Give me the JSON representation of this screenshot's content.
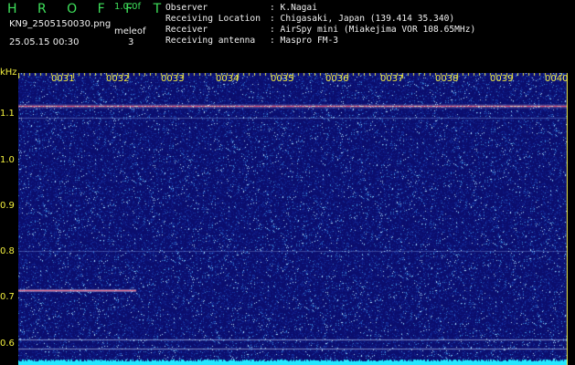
{
  "header": {
    "brand": "H R O F F T",
    "version": "1.0.0f",
    "filename": "KN9_2505150030.png",
    "meleof": "meleof",
    "datetime": "25.05.15 00:30",
    "value": "3",
    "observer_label": "Observer",
    "observer_value": ": K.Nagai",
    "location_label": "Receiving Location",
    "location_value": ": Chigasaki, Japan (139.414 35.340)",
    "receiver_label": "Receiver",
    "receiver_value": ": AirSpy mini (Miakejima VOR 108.65MHz)",
    "antenna_label": "Receiving antenna",
    "antenna_value": ": Maspro FM-3"
  },
  "axis": {
    "y_unit": "kHz",
    "x_ticks": [
      "0031",
      "0032",
      "0033",
      "0034",
      "0035",
      "0036",
      "0037",
      "0038",
      "0039",
      "0040"
    ],
    "y_ticks": [
      "1.1",
      "1.0",
      "0.9",
      "0.8",
      "0.7",
      "0.6"
    ]
  },
  "colors": {
    "background": "#0b0e6e",
    "text_yellow": "#f3ef3e",
    "text_green": "#3ee05a",
    "signal": "#ff4a6a",
    "floor": "#25e8ff"
  }
}
